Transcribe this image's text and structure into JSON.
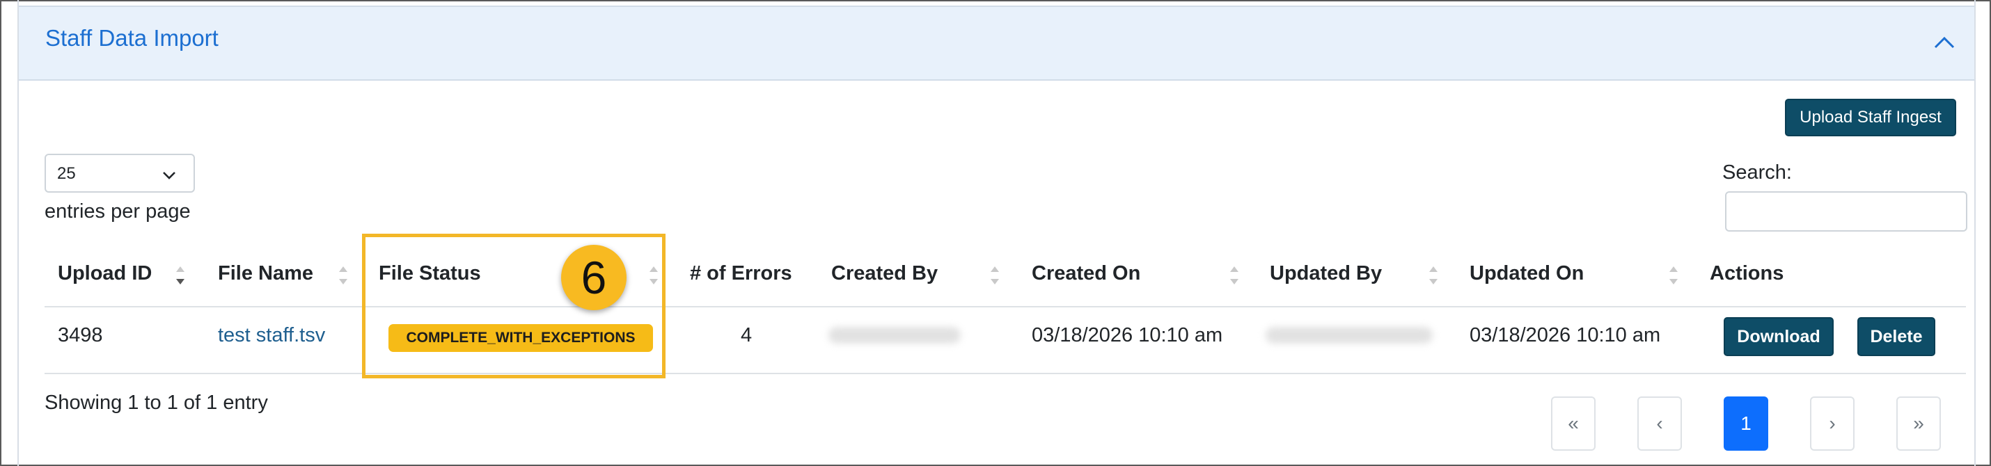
{
  "panel": {
    "title": "Staff Data Import"
  },
  "toolbar": {
    "upload_label": "Upload Staff Ingest"
  },
  "length": {
    "value": "25",
    "suffix": "entries per page"
  },
  "search": {
    "label": "Search:",
    "placeholder": ""
  },
  "table": {
    "headers": [
      "Upload ID",
      "File Name",
      "File Status",
      "# of Errors",
      "Created By",
      "Created On",
      "Updated By",
      "Updated On",
      "Actions"
    ],
    "rows": [
      {
        "upload_id": "3498",
        "file_name": "test staff.tsv",
        "file_status": "COMPLETE_WITH_EXCEPTIONS",
        "errors": "4",
        "created_on": "03/18/2026 10:10 am",
        "updated_on": "03/18/2026 10:10 am",
        "actions": [
          "Download",
          "Delete"
        ]
      }
    ]
  },
  "annotation": {
    "step": "6",
    "color": "#f8ba21"
  },
  "footer": {
    "info": "Showing 1 to 1 of 1 entry"
  },
  "pagination": {
    "first": "«",
    "prev": "‹",
    "current": "1",
    "next": "›",
    "last": "»"
  },
  "colors": {
    "primary_button": "#0e4d67",
    "title_link": "#1c6fd1",
    "badge_warning": "#f6bb17",
    "page_active": "#0d6efd"
  }
}
